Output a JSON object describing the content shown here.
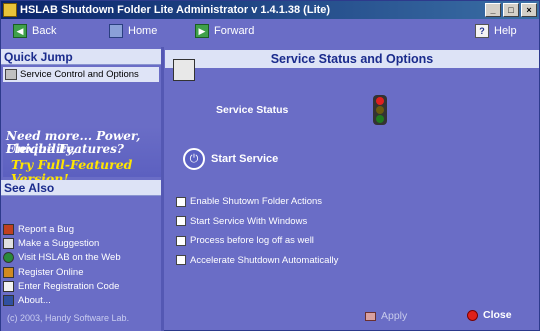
{
  "window": {
    "title": "HSLAB Shutdown Folder Lite Administrator v 1.4.1.38 (Lite)",
    "min": "_",
    "max": "□",
    "close": "×"
  },
  "toolbar": {
    "back": "Back",
    "home": "Home",
    "forward": "Forward",
    "help": "Help"
  },
  "sidebar": {
    "quick_jump": "Quick Jump",
    "selected_item": "Service Control and Options",
    "promo": {
      "line1": "Need more... Power, Flexibility,",
      "line2": "Unique Features?",
      "line3": "Try Full-Featured Version!"
    },
    "see_also": "See Also",
    "links": [
      {
        "label": "Report a Bug",
        "icon": "bug-icon",
        "color": "#c04020"
      },
      {
        "label": "Make a Suggestion",
        "icon": "suggestion-icon",
        "color": "#e0e0e0"
      },
      {
        "label": "Visit HSLAB on the Web",
        "icon": "globe-icon",
        "color": "#2a8a3a"
      },
      {
        "label": "Register Online",
        "icon": "register-icon",
        "color": "#d08a20"
      },
      {
        "label": "Enter Registration Code",
        "icon": "document-icon",
        "color": "#f2f2f2"
      },
      {
        "label": "About...",
        "icon": "about-icon",
        "color": "#3050a0"
      }
    ],
    "copyright": "(c) 2003, Handy Software Lab."
  },
  "main": {
    "header": "Service Status and Options",
    "service_status_label": "Service Status",
    "start_service": "Start Service",
    "options": [
      {
        "label": "Enable Shutown Folder Actions",
        "checked": false
      },
      {
        "label": "Start Service With Windows",
        "checked": false
      },
      {
        "label": "Process before log off as well",
        "checked": false
      },
      {
        "label": "Accelerate Shutdown Automatically",
        "checked": false
      }
    ],
    "apply": "Apply",
    "close": "Close"
  },
  "colors": {
    "background": "#6a6dc6",
    "header_bar": "#dde3f6",
    "header_text": "#1a2b8c",
    "promo_highlight": "#ffe600"
  }
}
